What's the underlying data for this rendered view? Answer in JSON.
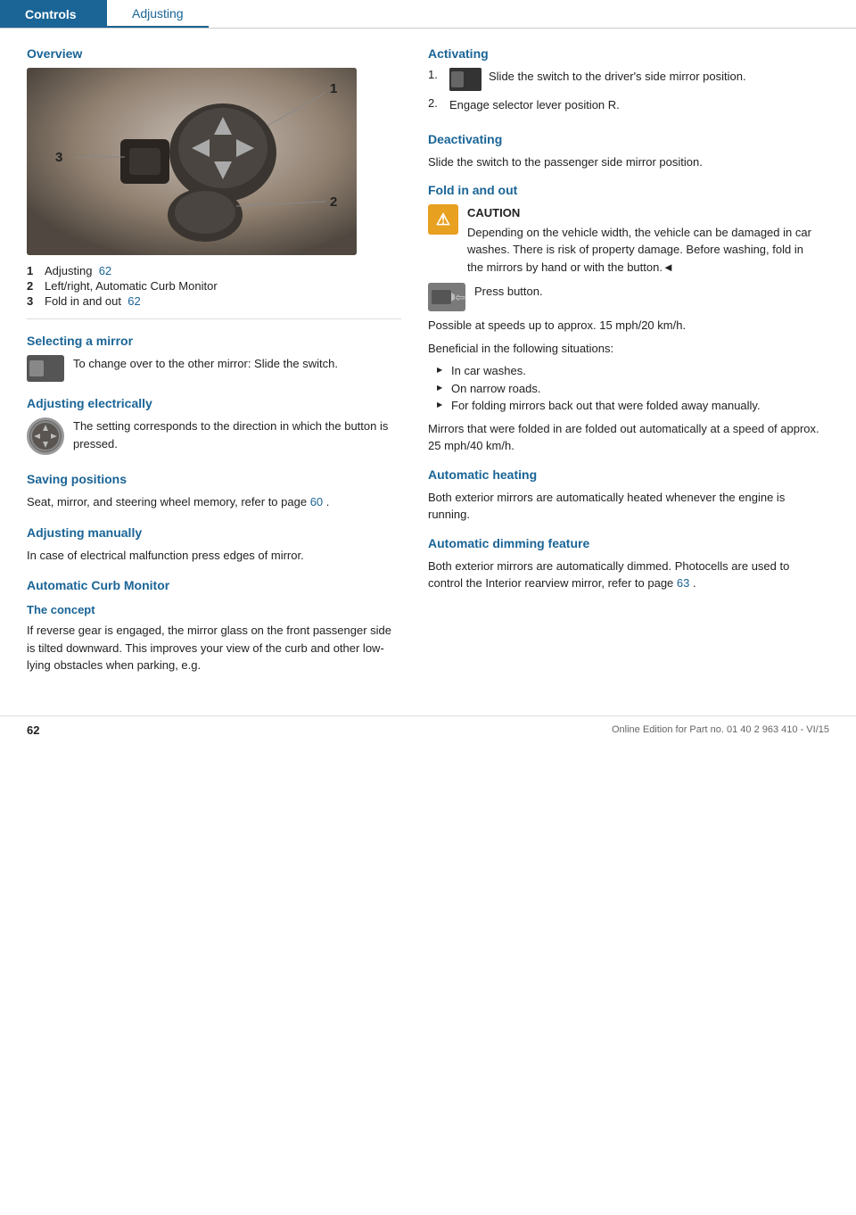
{
  "header": {
    "controls_label": "Controls",
    "adjusting_label": "Adjusting"
  },
  "left": {
    "overview_title": "Overview",
    "image_labels": [
      "1",
      "2",
      "3"
    ],
    "numbered_list": [
      {
        "num": "1",
        "text": "Adjusting",
        "link": "62"
      },
      {
        "num": "2",
        "text": "Left/right, Automatic Curb Monitor",
        "link": ""
      },
      {
        "num": "3",
        "text": "Fold in and out",
        "link": "62"
      }
    ],
    "selecting_mirror_title": "Selecting a mirror",
    "selecting_mirror_text": "To change over to the other mirror: Slide the switch.",
    "adjusting_electrically_title": "Adjusting electrically",
    "adjusting_electrically_text": "The setting corresponds to the direction in which the button is pressed.",
    "saving_positions_title": "Saving positions",
    "saving_positions_text1": "Seat, mirror, and steering wheel memory, refer to page",
    "saving_positions_link": "60",
    "saving_positions_text2": ".",
    "adjusting_manually_title": "Adjusting manually",
    "adjusting_manually_text": "In case of electrical malfunction press edges of mirror.",
    "automatic_curb_title": "Automatic Curb Monitor",
    "the_concept_title": "The concept",
    "the_concept_text": "If reverse gear is engaged, the mirror glass on the front passenger side is tilted downward. This improves your view of the curb and other low-lying obstacles when parking, e.g."
  },
  "right": {
    "activating_title": "Activating",
    "step1_text": "Slide the switch to the driver's side mirror position.",
    "step2_num": "2.",
    "step2_text": "Engage selector lever position R.",
    "deactivating_title": "Deactivating",
    "deactivating_text": "Slide the switch to the passenger side mirror position.",
    "fold_in_out_title": "Fold in and out",
    "caution_heading": "CAUTION",
    "caution_text": "Depending on the vehicle width, the vehicle can be damaged in car washes. There is risk of property damage. Before washing, fold in the mirrors by hand or with the button.◄",
    "press_button_text": "Press button.",
    "possible_speeds_text": "Possible at speeds up to approx. 15 mph/20 km/h.",
    "beneficial_text": "Beneficial in the following situations:",
    "bullets": [
      "In car washes.",
      "On narrow roads.",
      "For folding mirrors back out that were folded away manually."
    ],
    "mirrors_folded_text": "Mirrors that were folded in are folded out automatically at a speed of approx. 25 mph/40 km/h.",
    "automatic_heating_title": "Automatic heating",
    "automatic_heating_text": "Both exterior mirrors are automatically heated whenever the engine is running.",
    "automatic_dimming_title": "Automatic dimming feature",
    "automatic_dimming_text": "Both exterior mirrors are automatically dimmed. Photocells are used to control the Interior rearview mirror, refer to page",
    "automatic_dimming_link": "63",
    "automatic_dimming_text2": "."
  },
  "footer": {
    "page_number": "62",
    "footer_text": "Online Edition for Part no. 01 40 2 963 410 - VI/15"
  }
}
